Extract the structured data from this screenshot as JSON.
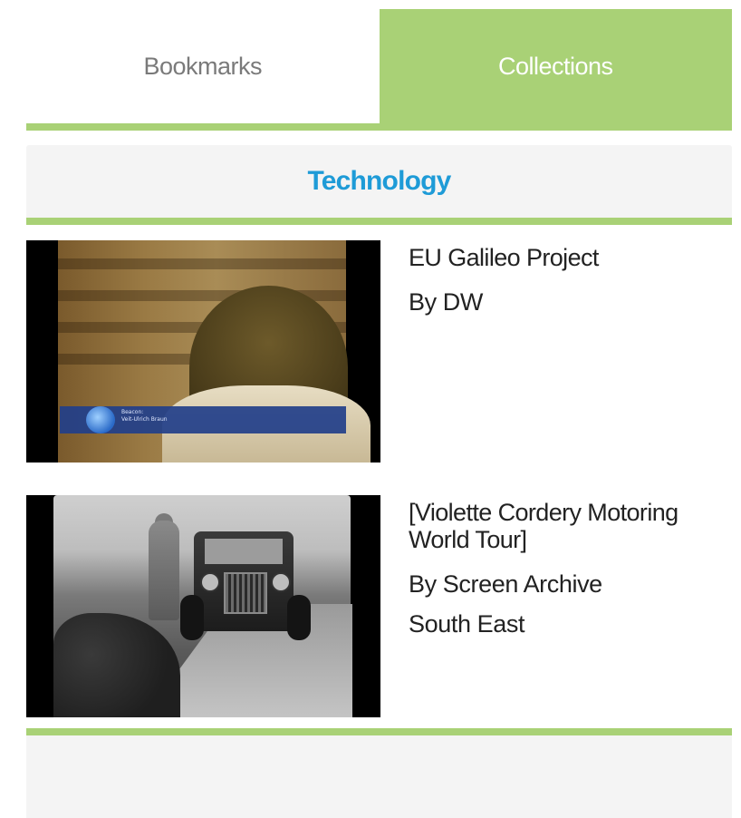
{
  "tabs": [
    {
      "label": "Bookmarks",
      "active": false
    },
    {
      "label": "Collections",
      "active": true
    }
  ],
  "section": {
    "title": "Technology"
  },
  "items": [
    {
      "title": "EU Galileo Project",
      "author": "By DW",
      "thumbnail_caption": [
        "Beacon:",
        "Veit-Ulrich Braun"
      ]
    },
    {
      "title": "[Violette Cordery Motoring World Tour]",
      "author": "By Screen Archive South East"
    }
  ],
  "colors": {
    "accent_green": "#a9d176",
    "title_blue": "#1e9bd7",
    "panel_gray": "#f4f4f4"
  }
}
